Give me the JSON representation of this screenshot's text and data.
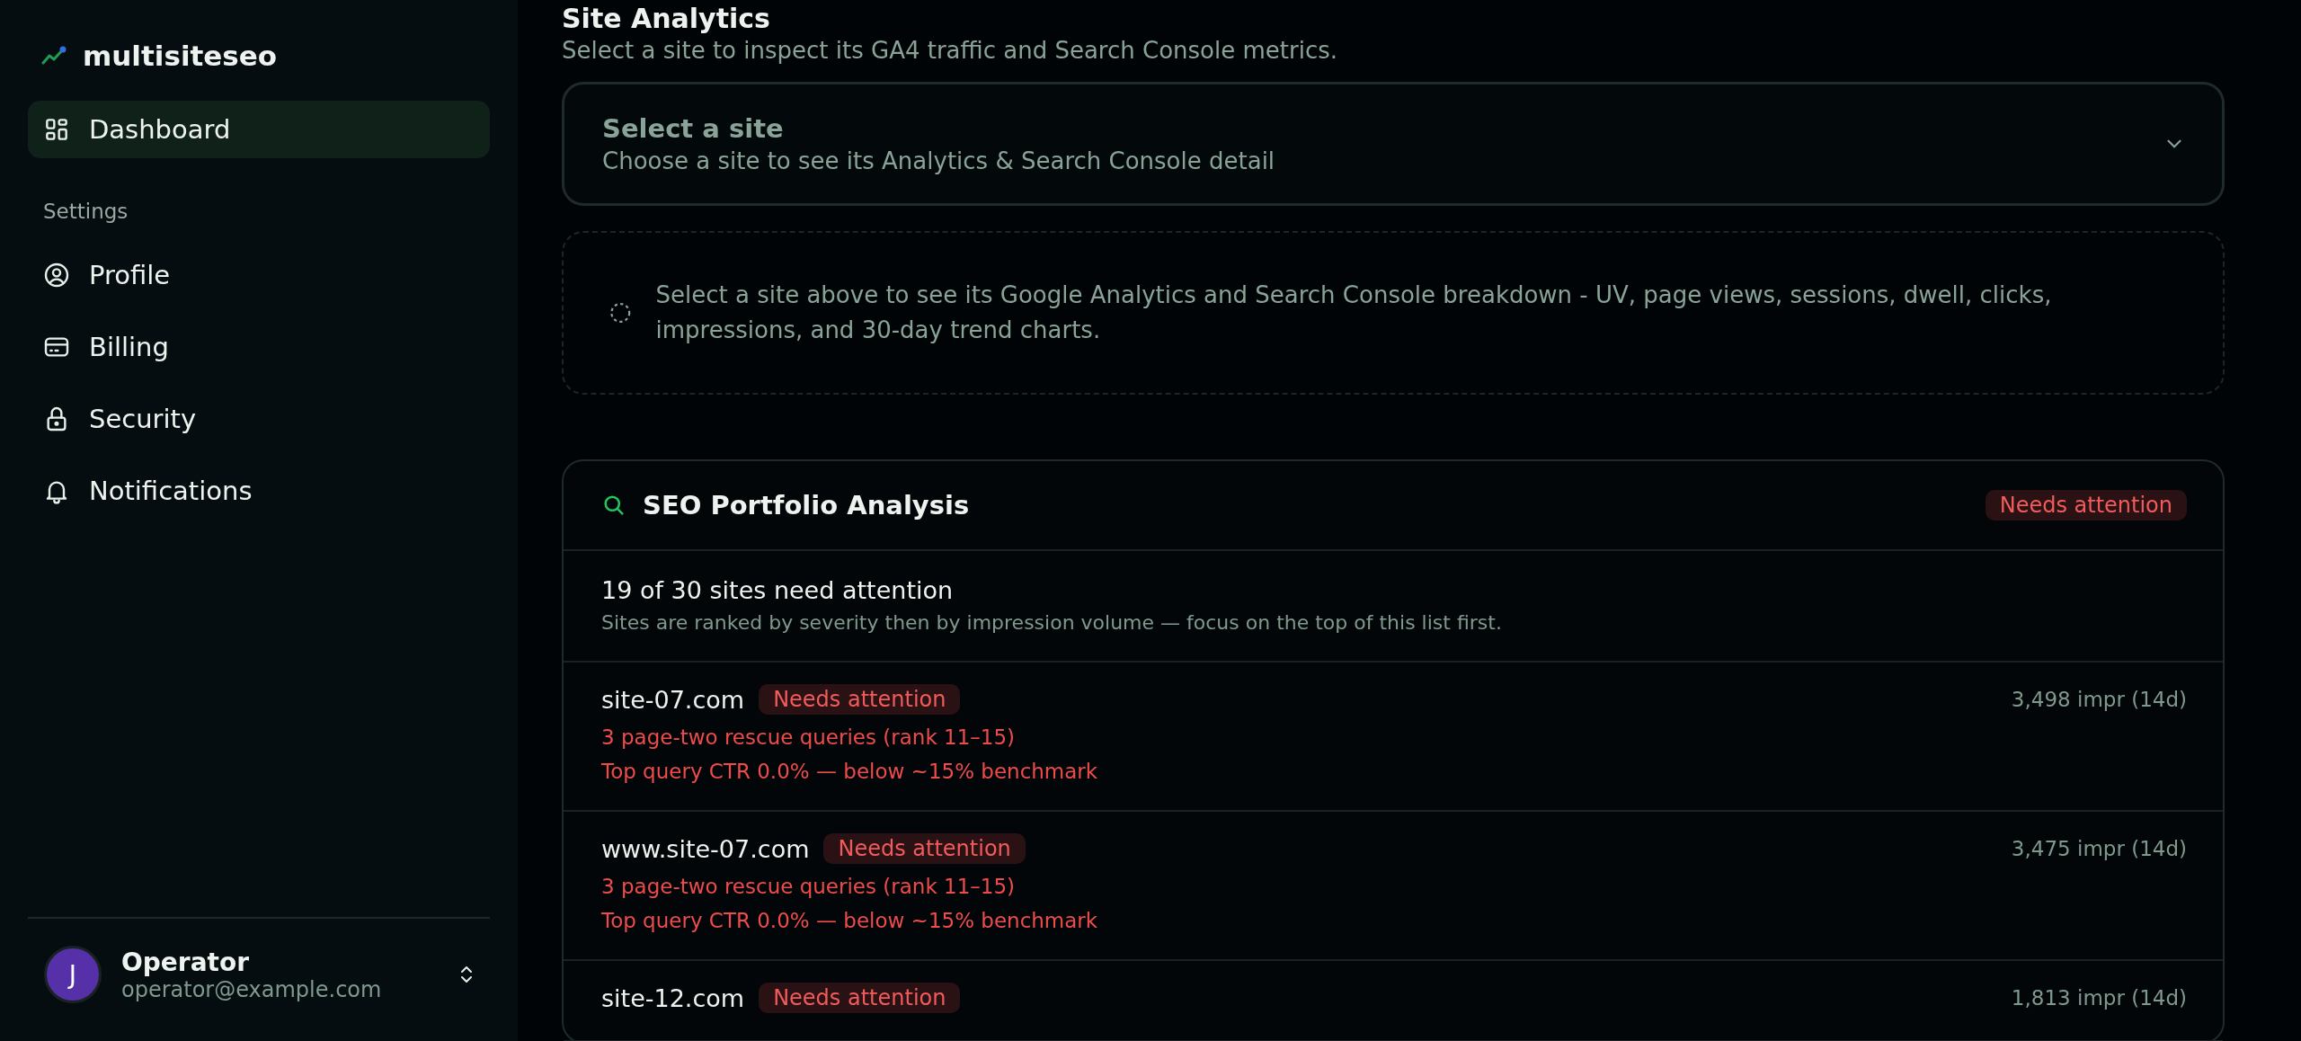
{
  "sidebar": {
    "brand": "multisiteseo",
    "nav": [
      {
        "label": "Dashboard",
        "selected": true
      }
    ],
    "section_label": "Settings",
    "settings": [
      {
        "label": "Profile",
        "selected": false
      },
      {
        "label": "Billing",
        "selected": false
      },
      {
        "label": "Security",
        "selected": false
      },
      {
        "label": "Notifications",
        "selected": false
      }
    ],
    "user": {
      "initial": "J",
      "name": "Operator",
      "email": "operator@example.com"
    }
  },
  "page": {
    "title": "Site Analytics",
    "subtitle": "Select a site to inspect its GA4 traffic and Search Console metrics."
  },
  "site_select": {
    "title": "Select a site",
    "hint": "Choose a site to see its Analytics & Search Console detail"
  },
  "empty_state": {
    "text": "Select a site above to see its Google Analytics and Search Console breakdown - UV, page views, sessions, dwell, clicks, impressions, and 30-day trend charts."
  },
  "analysis": {
    "title": "SEO Portfolio Analysis",
    "badge": "Needs attention",
    "summary": "19 of 30 sites need attention",
    "note": "Sites are ranked by severity then by impression volume — focus on the top of this list first.",
    "sites": [
      {
        "name": "site-07.com",
        "badge": "Needs attention",
        "impressions": "3,498 impr (14d)",
        "issues": [
          "3 page-two rescue queries (rank 11–15)",
          "Top query CTR 0.0% — below ~15% benchmark"
        ]
      },
      {
        "name": "www.site-07.com",
        "badge": "Needs attention",
        "impressions": "3,475 impr (14d)",
        "issues": [
          "3 page-two rescue queries (rank 11–15)",
          "Top query CTR 0.0% — below ~15% benchmark"
        ]
      },
      {
        "name": "site-12.com",
        "badge": "Needs attention",
        "impressions": "1,813 impr (14d)"
      }
    ]
  }
}
